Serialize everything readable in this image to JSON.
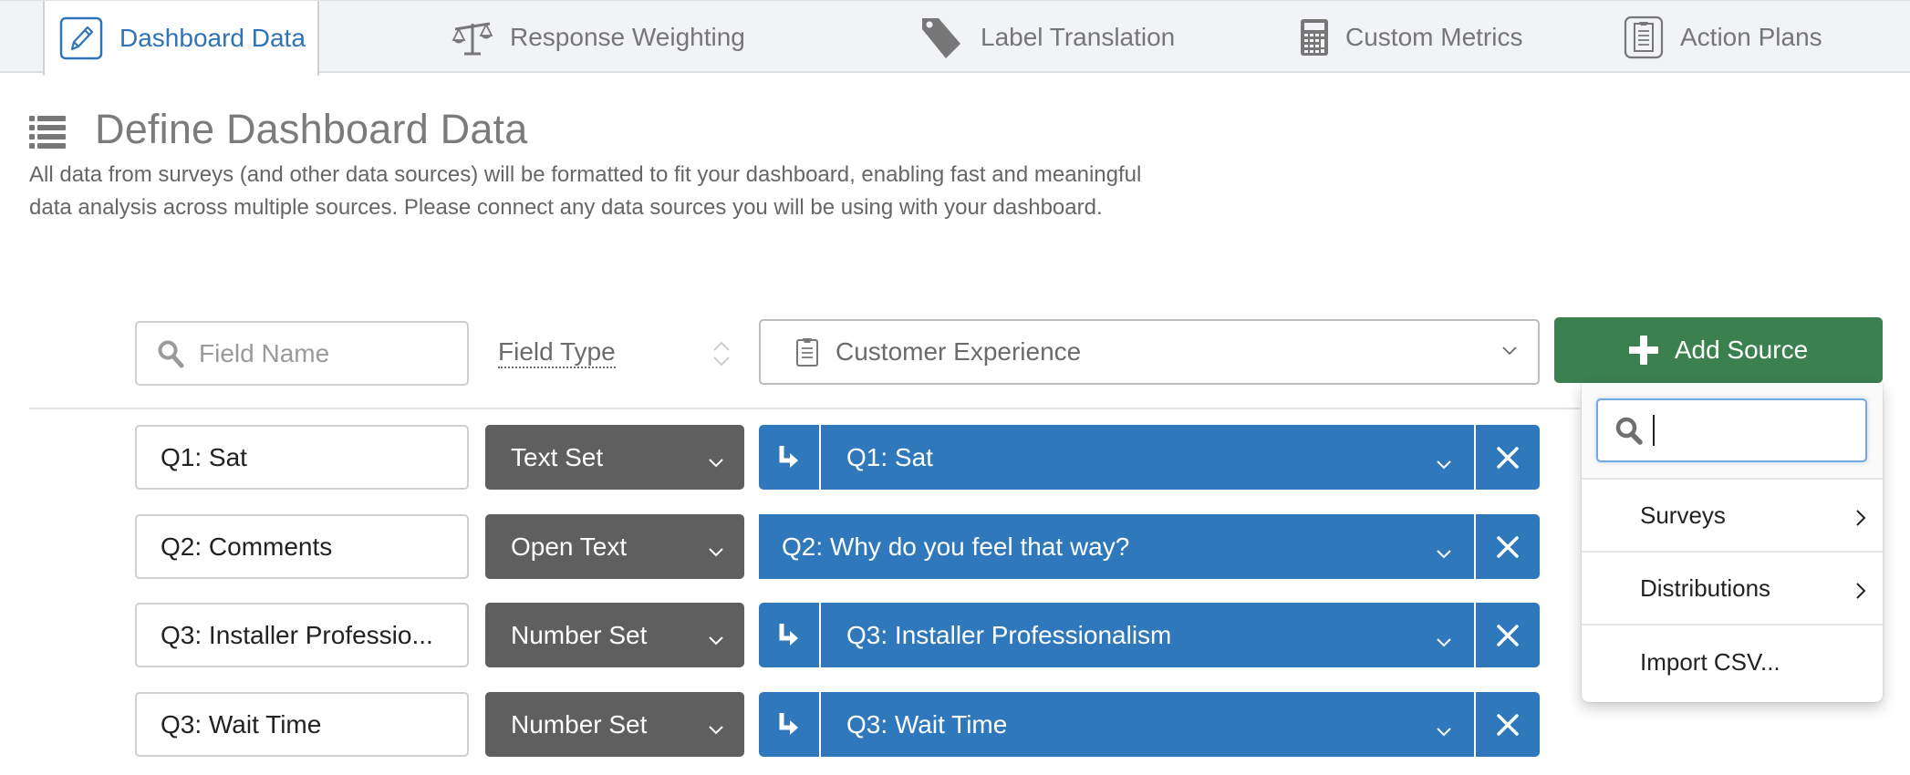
{
  "tabs": [
    {
      "label": "Dashboard Data",
      "icon": "pencil-icon",
      "active": true
    },
    {
      "label": "Response Weighting",
      "icon": "scale-icon",
      "active": false
    },
    {
      "label": "Label Translation",
      "icon": "tag-icon",
      "active": false
    },
    {
      "label": "Custom Metrics",
      "icon": "calculator-icon",
      "active": false
    },
    {
      "label": "Action Plans",
      "icon": "clipboard-icon",
      "active": false
    }
  ],
  "header": {
    "title": "Define Dashboard Data",
    "icon": "list-icon",
    "description": "All data from surveys (and other data sources) will be formatted to fit your dashboard, enabling fast and meaningful data analysis across multiple sources. Please connect any data sources you will be using with your dashboard."
  },
  "filters": {
    "field_name_placeholder": "Field Name",
    "field_name_value": "",
    "field_type_label": "Field Type",
    "source_selected": "Customer Experience",
    "add_source_label": "Add Source"
  },
  "colors": {
    "accent_blue": "#2f78bb",
    "add_green": "#3b8150",
    "type_gray": "#5f5f5f",
    "active_tab_text": "#2f73b8"
  },
  "rows": [
    {
      "field_name": "Q1: Sat",
      "field_type": "Text Set",
      "source_field": "Q1: Sat",
      "mapped_arrow": true
    },
    {
      "field_name": "Q2: Comments",
      "field_type": "Open Text",
      "source_field": "Q2: Why do you feel that way?",
      "mapped_arrow": false
    },
    {
      "field_name": "Q3: Installer Professio...",
      "field_type": "Number Set",
      "source_field": "Q3: Installer Professionalism",
      "mapped_arrow": true
    },
    {
      "field_name": "Q3: Wait Time",
      "field_type": "Number Set",
      "source_field": "Q3: Wait Time",
      "mapped_arrow": true
    }
  ],
  "add_source_menu": {
    "search_value": "",
    "items": [
      {
        "label": "Surveys",
        "has_submenu": true
      },
      {
        "label": "Distributions",
        "has_submenu": true
      },
      {
        "label": "Import CSV...",
        "has_submenu": false
      }
    ]
  }
}
